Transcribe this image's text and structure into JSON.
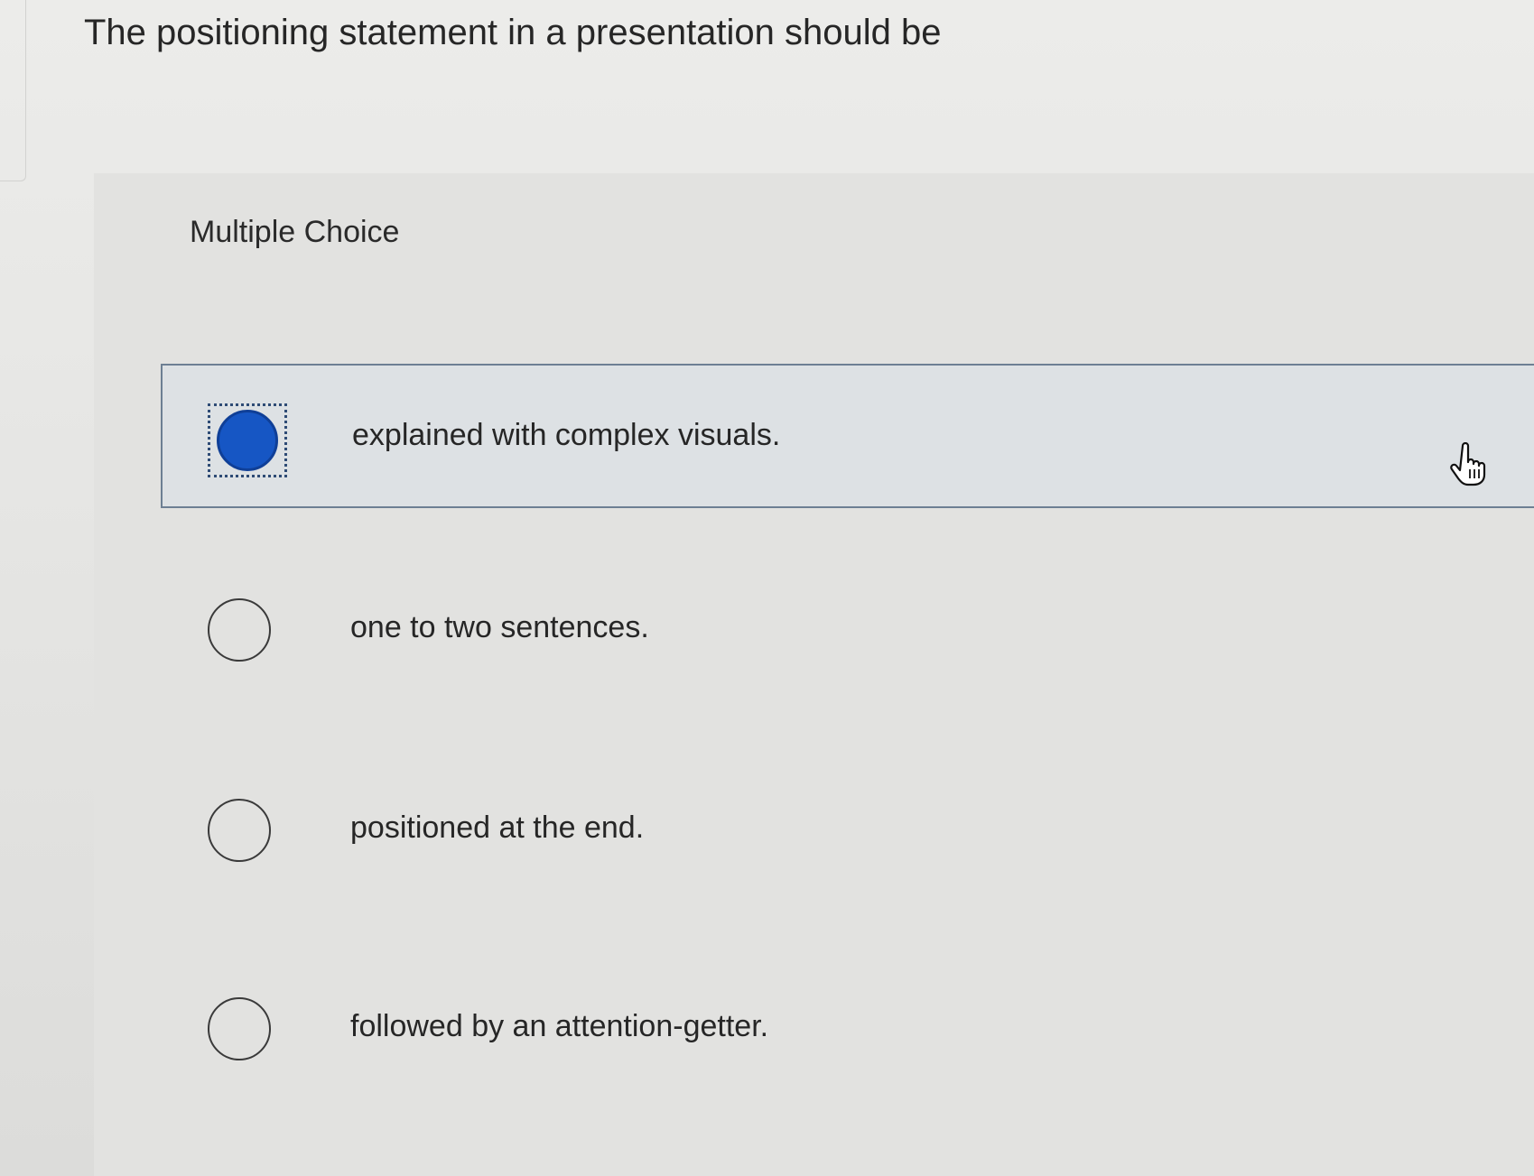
{
  "question": {
    "text": "The positioning statement in a presentation should be"
  },
  "question_type": "Multiple Choice",
  "options": [
    {
      "label": "explained with complex visuals.",
      "selected": true
    },
    {
      "label": "one to two sentences.",
      "selected": false
    },
    {
      "label": "positioned at the end.",
      "selected": false
    },
    {
      "label": "followed by an attention-getter.",
      "selected": false
    }
  ],
  "colors": {
    "selected_radio": "#1656c4",
    "selected_border": "#6d7f93",
    "page_background": "#e9e9e7"
  },
  "icons": {
    "cursor": "hand-pointer-icon"
  }
}
